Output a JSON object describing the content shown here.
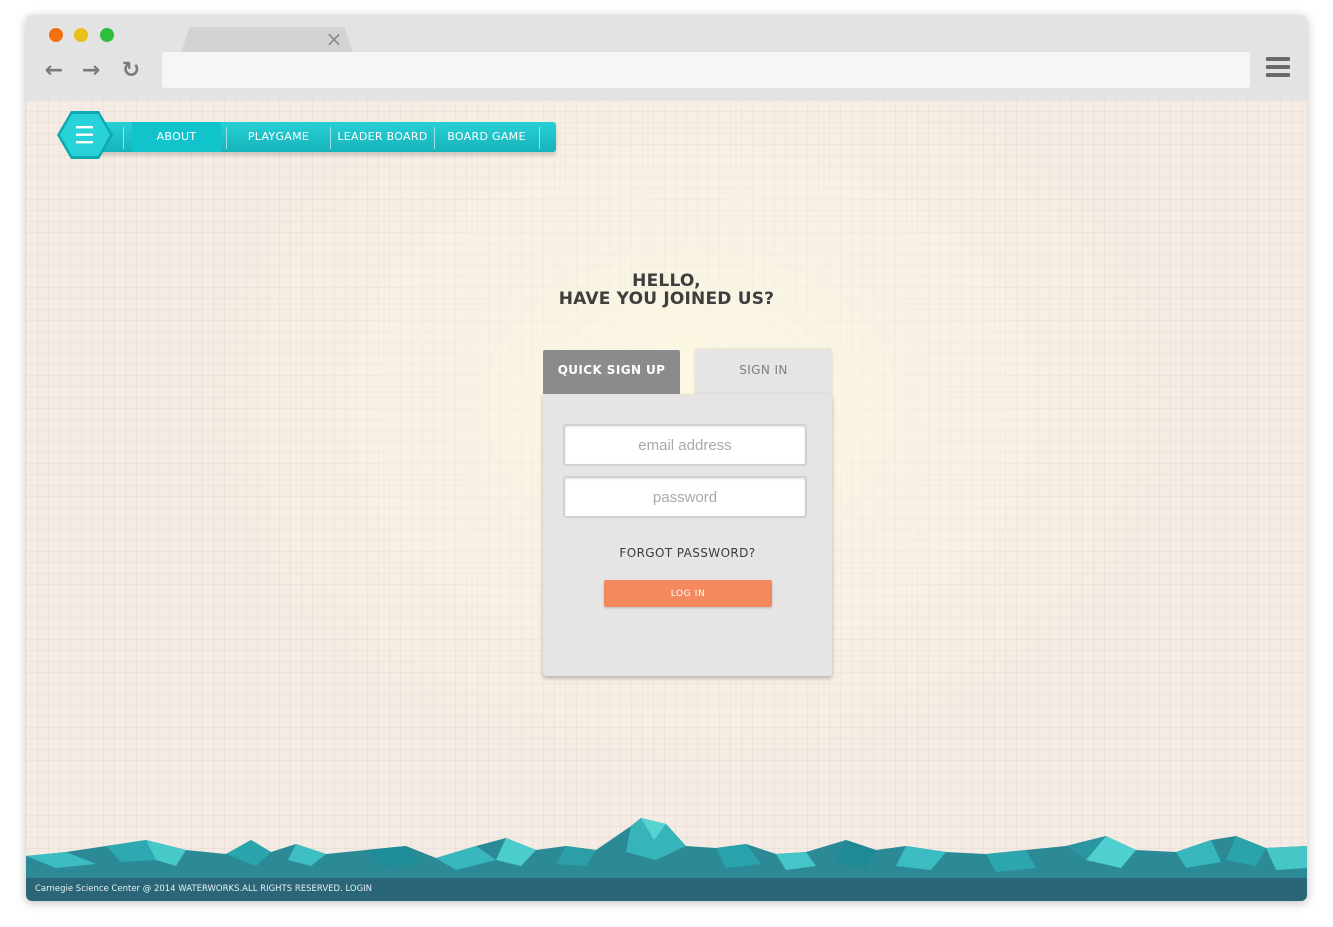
{
  "browser": {
    "tab_close_glyph": "×",
    "back_glyph": "←",
    "forward_glyph": "→",
    "reload_glyph": "↻",
    "url": "",
    "icons": [
      "back-arrow-icon",
      "forward-arrow-icon",
      "reload-icon",
      "menu-icon",
      "close-icon"
    ],
    "traffic_light_colors": [
      "#f3700f",
      "#e7c01a",
      "#2fbd3d"
    ]
  },
  "nav": {
    "menu_icon": "hexagon-menu-icon",
    "items": [
      {
        "label": "ABOUT",
        "active": true
      },
      {
        "label": "PLAYGAME",
        "active": false
      },
      {
        "label": "LEADER BOARD",
        "active": false
      },
      {
        "label": "BOARD GAME",
        "active": false
      }
    ],
    "accent_color": "#1cc3ca"
  },
  "greeting": {
    "line1": "HELLO,",
    "line2": "HAVE YOU JOINED US?"
  },
  "auth": {
    "tabs": {
      "signup": "QUICK SIGN UP",
      "signin": "SIGN IN"
    },
    "email_placeholder": "email address",
    "password_placeholder": "password",
    "forgot": "FORGOT PASSWORD?",
    "login_button": "LOG IN",
    "button_color": "#f4895d"
  },
  "footer": {
    "text": "Carnegie Science Center @ 2014 WATERWORKS.ALL RIGHTS RESERVED. LOGIN",
    "color": "#2a6678"
  }
}
